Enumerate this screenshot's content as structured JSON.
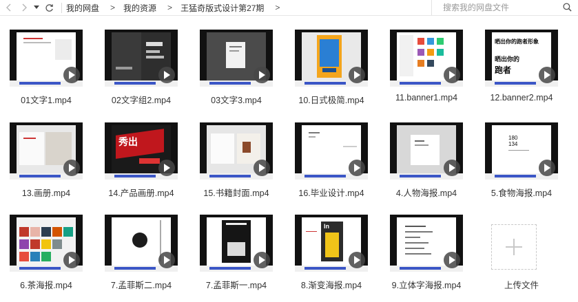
{
  "nav": {
    "breadcrumbs": [
      "我的网盘",
      "我的资源",
      "王猛奇版式设计第27期"
    ],
    "search_placeholder": "搜索我的网盘文件"
  },
  "files": [
    {
      "name": "01文字1.mp4",
      "thumb": "doc"
    },
    {
      "name": "02文字组2.mp4",
      "thumb": "dark"
    },
    {
      "name": "03文字3.mp4",
      "thumb": "gray"
    },
    {
      "name": "10.日式极简.mp4",
      "thumb": "poster-blue"
    },
    {
      "name": "11.banner1.mp4",
      "thumb": "web"
    },
    {
      "name": "12.banner2.mp4",
      "thumb": "type-black"
    },
    {
      "name": "13.画册.mp4",
      "thumb": "book"
    },
    {
      "name": "14.产品画册.mp4",
      "thumb": "red"
    },
    {
      "name": "15.书籍封面.mp4",
      "thumb": "book2"
    },
    {
      "name": "16.毕业设计.mp4",
      "thumb": "doc"
    },
    {
      "name": "4.人物海报.mp4",
      "thumb": "gray-doc"
    },
    {
      "name": "5.食物海报.mp4",
      "thumb": "numbers"
    },
    {
      "name": "6.茶海报.mp4",
      "thumb": "collage"
    },
    {
      "name": "7.孟菲斯二.mp4",
      "thumb": "memphis"
    },
    {
      "name": "7.孟菲斯一.mp4",
      "thumb": "memphis-poster"
    },
    {
      "name": "8.渐变海报.mp4",
      "thumb": "gradient"
    },
    {
      "name": "9.立体字海报.mp4",
      "thumb": "text-doc"
    }
  ],
  "upload": {
    "label": "上传文件"
  },
  "thumb_texts": {
    "t12_line1": "晒出你的跑者形象",
    "t12_line2": "晒出你的",
    "t12_line3": "跑者",
    "t14": "秀出",
    "t5": "180\n134",
    "t8": "In"
  }
}
